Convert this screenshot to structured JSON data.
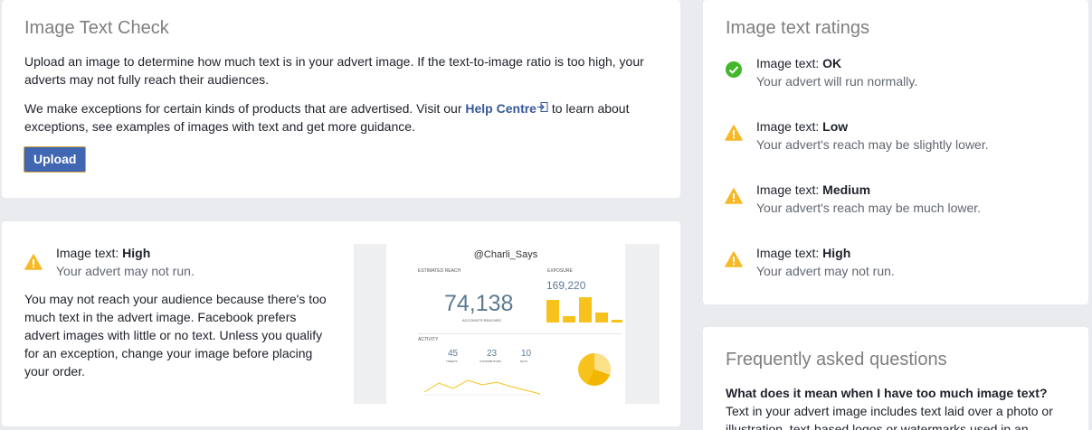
{
  "check": {
    "title": "Image Text Check",
    "p1": "Upload an image to determine how much text is in your advert image. If the text-to-image ratio is too high, your adverts may not fully reach their audiences.",
    "p2_before": "We make exceptions for certain kinds of products that are advertised. Visit our ",
    "p2_link": "Help Centre",
    "p2_after": " to learn about exceptions, see examples of images with text and get more guidance.",
    "upload_label": "Upload"
  },
  "result": {
    "prefix": "Image text: ",
    "level": "High",
    "sub": "Your advert may not run.",
    "body": "You may not reach your audience because there's too much text in the advert image. Facebook prefers advert images with little or no text. Unless you qualify for an exception, change your image before placing your order."
  },
  "preview": {
    "handle": "@Charli_Says",
    "reach_label": "ESTIMATED REACH",
    "exposure_label": "EXPOSURE",
    "exposure_value": "169,220",
    "reach_value": "74,138",
    "reach_sub": "ACCOUNTS REACHED",
    "activity_label": "ACTIVITY",
    "stats": [
      {
        "value": "45",
        "label": "TWEETS"
      },
      {
        "value": "23",
        "label": "CONTRIBUTORS"
      },
      {
        "value": "10",
        "label": "DAYS"
      }
    ]
  },
  "ratings": {
    "title": "Image text ratings",
    "prefix": "Image text: ",
    "items": [
      {
        "level": "OK",
        "sub": "Your advert will run normally.",
        "icon": "check-circle-icon",
        "color": "#42b72a"
      },
      {
        "level": "Low",
        "sub": "Your advert's reach may be slightly lower.",
        "icon": "warning-icon",
        "color": "#f7b928"
      },
      {
        "level": "Medium",
        "sub": "Your advert's reach may be much lower.",
        "icon": "warning-icon",
        "color": "#f7b928"
      },
      {
        "level": "High",
        "sub": "Your advert may not run.",
        "icon": "warning-icon",
        "color": "#f7b928"
      }
    ]
  },
  "faq": {
    "title": "Frequently asked questions",
    "q1": "What does it mean when I have too much image text?",
    "a1": "Text in your advert image includes text laid over a photo or illustration, text-based logos or watermarks used in an"
  }
}
